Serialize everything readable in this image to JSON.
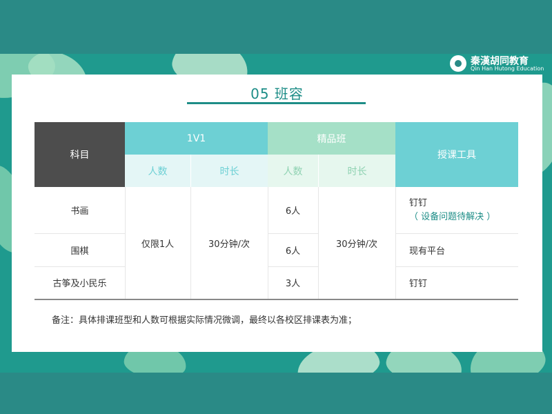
{
  "logo": {
    "cn": "秦漢胡同教育",
    "en": "Qin Han Hutong Education"
  },
  "title": "05 班容",
  "table": {
    "headers": {
      "subject": "科目",
      "group_1v1": "1V1",
      "group_boutique": "精品班",
      "tools": "授课工具",
      "people": "人数",
      "duration": "时长"
    },
    "rows": [
      {
        "subject": "书画",
        "boutique_people": "6人",
        "tool_line1": "钉钉",
        "tool_line2": "（ 设备问题待解决 ）"
      },
      {
        "subject": "围棋",
        "boutique_people": "6人",
        "tool_line1": "现有平台"
      },
      {
        "subject": "古筝及小民乐",
        "boutique_people": "3人",
        "tool_line1": "钉钉"
      }
    ],
    "merged": {
      "v1_people": "仅限1人",
      "v1_duration": "30分钟/次",
      "boutique_duration": "30分钟/次"
    }
  },
  "note": "备注：具体排课班型和人数可根据实际情况微调，最终以各校区排课表为准；",
  "colors": {
    "teal": "#1d8d87",
    "header_cyan": "#6dd0d4",
    "header_green": "#a5e0c7",
    "dark": "#4d4d4d"
  }
}
